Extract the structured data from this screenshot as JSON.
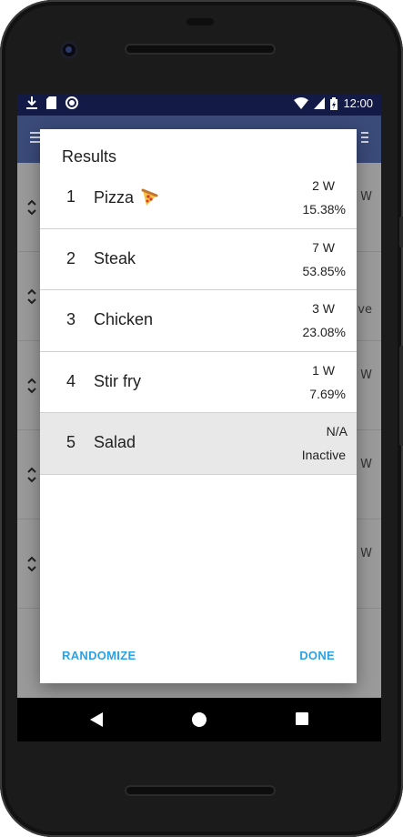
{
  "status_bar": {
    "time": "12:00"
  },
  "background_list": [
    {
      "right_text": "W"
    },
    {
      "right_text": "ve"
    },
    {
      "right_text": "W"
    },
    {
      "right_text": "W"
    },
    {
      "right_text": "W"
    }
  ],
  "dialog": {
    "title": "Results",
    "results": [
      {
        "rank": "1",
        "name": "Pizza",
        "icon": "pizza-icon",
        "wins": "2 W",
        "percent": "15.38%"
      },
      {
        "rank": "2",
        "name": "Steak",
        "wins": "7 W",
        "percent": "53.85%"
      },
      {
        "rank": "3",
        "name": "Chicken",
        "wins": "3 W",
        "percent": "23.08%"
      },
      {
        "rank": "4",
        "name": "Stir fry",
        "wins": "1 W",
        "percent": "7.69%"
      },
      {
        "rank": "5",
        "name": "Salad",
        "wins": "N/A",
        "percent": "Inactive"
      }
    ],
    "actions": {
      "randomize": "RANDOMIZE",
      "done": "DONE"
    }
  },
  "colors": {
    "accent": "#2aa3e6",
    "status_bar": "#121a45",
    "app_bar": "#3a4a79",
    "inactive_row": "#e8e8e8"
  }
}
